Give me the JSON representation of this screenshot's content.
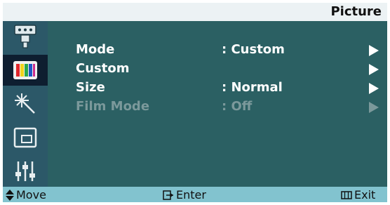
{
  "header": {
    "title": "Picture"
  },
  "sidebar": {
    "items": [
      {
        "icon": "input-source-icon",
        "selected": false
      },
      {
        "icon": "picture-color-bars-icon",
        "selected": true
      },
      {
        "icon": "magic-wand-icon",
        "selected": false
      },
      {
        "icon": "pip-window-icon",
        "selected": false
      },
      {
        "icon": "settings-sliders-icon",
        "selected": false
      }
    ]
  },
  "menu": {
    "rows": [
      {
        "label": "Mode",
        "value": ": Custom",
        "enabled": true
      },
      {
        "label": "Custom",
        "value": "",
        "enabled": true
      },
      {
        "label": "Size",
        "value": ": Normal",
        "enabled": true
      },
      {
        "label": "Film Mode",
        "value": ": Off",
        "enabled": false
      }
    ]
  },
  "footer": {
    "move_label": "Move",
    "enter_label": "Enter",
    "exit_label": "Exit"
  },
  "colors": {
    "content_bg": "#2b6063",
    "sidebar_bg": "#2c5868",
    "selected_bg": "#0e1e30",
    "status_bg": "#82c3cf",
    "title_bg": "#ecf2f4",
    "disabled_text": "#7b999b"
  }
}
